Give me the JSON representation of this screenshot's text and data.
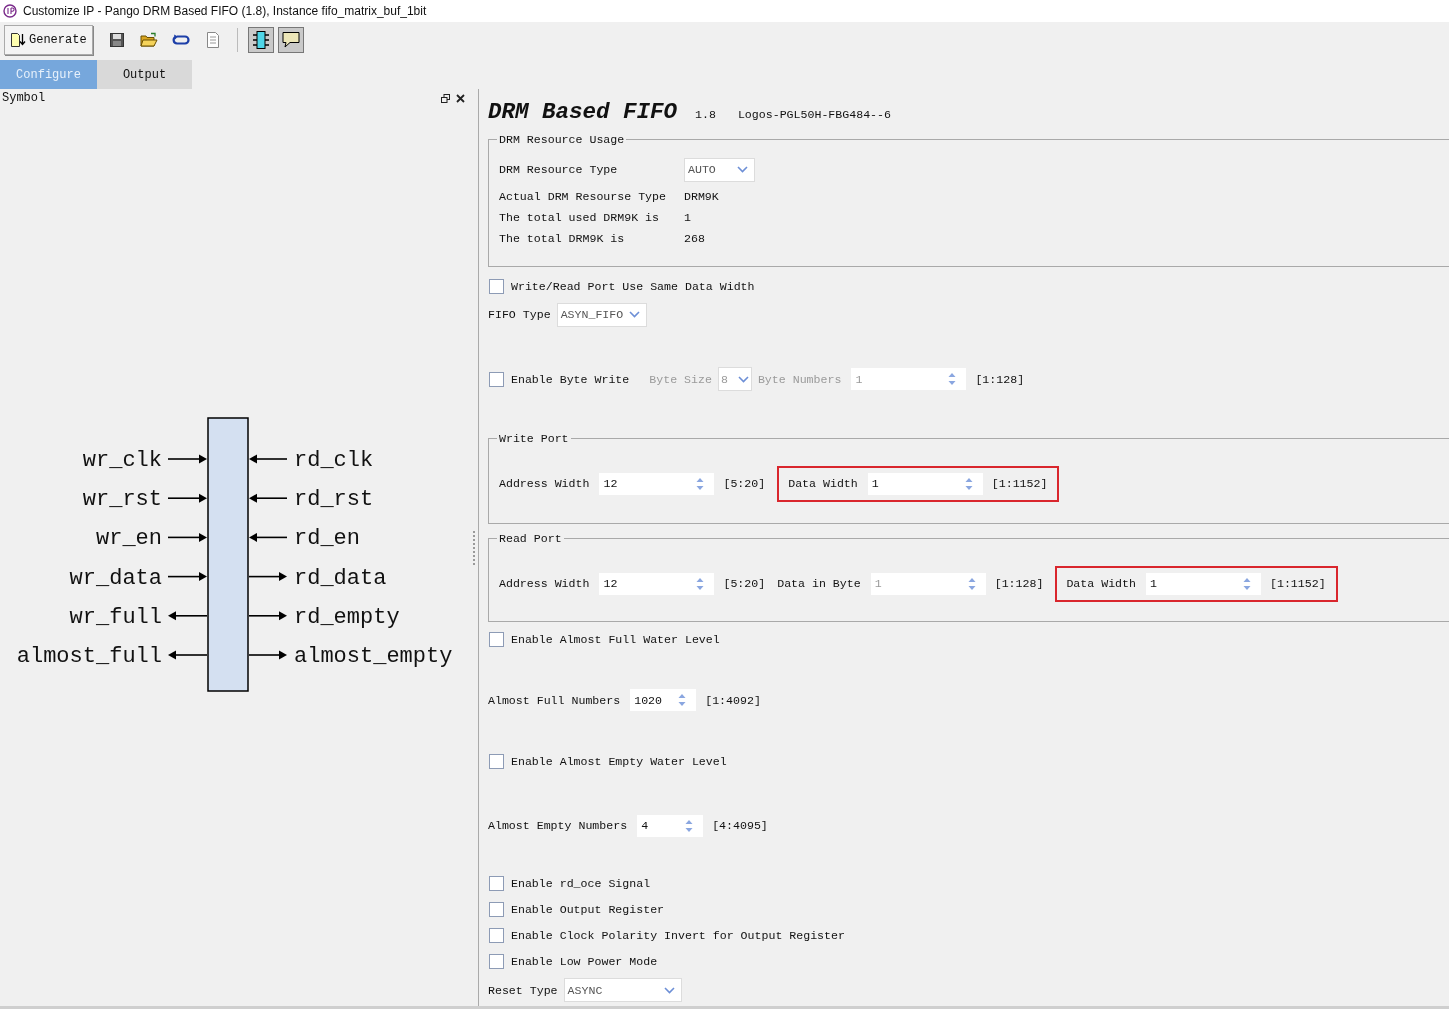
{
  "window": {
    "title": "Customize IP - Pango DRM Based FIFO (1.8), Instance fifo_matrix_buf_1bit"
  },
  "toolbar": [
    {
      "kind": "generate",
      "label": "Generate"
    },
    {
      "kind": "save",
      "pressed": false
    },
    {
      "kind": "open",
      "pressed": false
    },
    {
      "kind": "refresh",
      "pressed": false
    },
    {
      "kind": "document",
      "pressed": false
    },
    {
      "kind": "symbol",
      "pressed": true
    },
    {
      "kind": "comment",
      "pressed": true
    }
  ],
  "tabs": [
    {
      "label": "Configure",
      "selected": true
    },
    {
      "label": "Output",
      "selected": false
    }
  ],
  "symbol_panel": {
    "title": "Symbol",
    "left_pins": [
      {
        "name": "wr_clk",
        "kind": "input"
      },
      {
        "name": "wr_rst",
        "kind": "input"
      },
      {
        "name": "wr_en",
        "kind": "input"
      },
      {
        "name": "wr_data",
        "kind": "input"
      },
      {
        "name": "wr_full",
        "kind": "output"
      },
      {
        "name": "almost_full",
        "kind": "output"
      }
    ],
    "right_pins": [
      {
        "name": "rd_clk",
        "kind": "input"
      },
      {
        "name": "rd_rst",
        "kind": "input"
      },
      {
        "name": "rd_en",
        "kind": "input"
      },
      {
        "name": "rd_data",
        "kind": "output"
      },
      {
        "name": "rd_empty",
        "kind": "output"
      },
      {
        "name": "almost_empty",
        "kind": "output"
      }
    ]
  },
  "config": {
    "title": "DRM Based FIFO",
    "version": "1.8",
    "device": "Logos-PGL50H-FBG484--6",
    "items": [
      {
        "kind": "group",
        "title": "DRM Resource Usage",
        "rows": [
          {
            "label": "DRM Resource Type",
            "field": {
              "kind": "combo",
              "value": "AUTO",
              "disabled": false
            }
          },
          {
            "label": "Actual DRM Resourse Type",
            "field": {
              "kind": "info",
              "value": "DRM9K"
            }
          },
          {
            "label": "The total used DRM9K is",
            "field": {
              "kind": "info",
              "value": "1"
            }
          },
          {
            "label": "The total DRM9K is",
            "field": {
              "kind": "info",
              "value": "268"
            }
          }
        ]
      },
      {
        "kind": "row",
        "fields": [
          {
            "kind": "checkbox",
            "label": "Write/Read Port Use Same Data Width",
            "checked": false
          }
        ]
      },
      {
        "kind": "row",
        "fields": [
          {
            "kind": "label",
            "text": "FIFO Type",
            "disabled": false
          },
          {
            "kind": "combo",
            "value": "ASYN_FIFO",
            "disabled": false
          }
        ]
      },
      {
        "kind": "row",
        "fields": [
          {
            "kind": "checkbox",
            "label": "Enable Byte Write",
            "checked": false
          },
          {
            "kind": "label",
            "text": "Byte Size",
            "disabled": true
          },
          {
            "kind": "combo",
            "value": "8",
            "disabled": true
          },
          {
            "kind": "label",
            "text": "Byte Numbers",
            "disabled": true
          },
          {
            "kind": "spin",
            "value": "1",
            "disabled": true
          },
          {
            "kind": "range",
            "text": "[1:128]"
          }
        ]
      },
      {
        "kind": "portgroup",
        "title": "Write Port",
        "fields": [
          {
            "kind": "label",
            "text": "Address Width",
            "disabled": false
          },
          {
            "kind": "spin",
            "value": "12",
            "disabled": false
          },
          {
            "kind": "range",
            "text": "[5:20]"
          },
          {
            "kind": "highlight",
            "fields": [
              {
                "kind": "label",
                "text": "Data Width",
                "disabled": false
              },
              {
                "kind": "spin",
                "value": "1",
                "disabled": false
              },
              {
                "kind": "range",
                "text": "[1:1152]"
              }
            ]
          }
        ]
      },
      {
        "kind": "portgroup",
        "title": "Read Port",
        "fields": [
          {
            "kind": "label",
            "text": "Address Width",
            "disabled": false
          },
          {
            "kind": "spin",
            "value": "12",
            "disabled": false
          },
          {
            "kind": "range",
            "text": "[5:20]"
          },
          {
            "kind": "label",
            "text": "Data in Byte",
            "disabled": false
          },
          {
            "kind": "spin",
            "value": "1",
            "disabled": true
          },
          {
            "kind": "range",
            "text": "[1:128]"
          },
          {
            "kind": "highlight",
            "fields": [
              {
                "kind": "label",
                "text": "Data Width",
                "disabled": false
              },
              {
                "kind": "spin",
                "value": "1",
                "disabled": false
              },
              {
                "kind": "range",
                "text": "[1:1152]"
              }
            ]
          }
        ]
      },
      {
        "kind": "row",
        "fields": [
          {
            "kind": "checkbox",
            "label": "Enable Almost Full Water Level",
            "checked": false
          }
        ]
      },
      {
        "kind": "row",
        "fields": [
          {
            "kind": "label",
            "text": "Almost Full Numbers",
            "disabled": false
          },
          {
            "kind": "spin",
            "value": "1020",
            "disabled": false
          },
          {
            "kind": "range",
            "text": "[1:4092]"
          }
        ]
      },
      {
        "kind": "row",
        "fields": [
          {
            "kind": "checkbox",
            "label": "Enable Almost Empty Water Level",
            "checked": false
          }
        ]
      },
      {
        "kind": "row",
        "fields": [
          {
            "kind": "label",
            "text": "Almost Empty Numbers",
            "disabled": false
          },
          {
            "kind": "spin",
            "value": "4",
            "disabled": false
          },
          {
            "kind": "range",
            "text": "[4:4095]"
          }
        ]
      },
      {
        "kind": "row",
        "fields": [
          {
            "kind": "checkbox",
            "label": "Enable rd_oce Signal",
            "checked": false
          }
        ]
      },
      {
        "kind": "row",
        "fields": [
          {
            "kind": "checkbox",
            "label": "Enable Output Register",
            "checked": false
          }
        ]
      },
      {
        "kind": "row",
        "fields": [
          {
            "kind": "checkbox",
            "label": "Enable Clock Polarity Invert for Output Register",
            "checked": false
          }
        ]
      },
      {
        "kind": "row",
        "fields": [
          {
            "kind": "checkbox",
            "label": "Enable Low Power Mode",
            "checked": false
          }
        ]
      },
      {
        "kind": "row",
        "fields": [
          {
            "kind": "label",
            "text": "Reset Type",
            "disabled": false
          },
          {
            "kind": "combo",
            "value": "ASYNC",
            "disabled": false
          }
        ]
      }
    ]
  }
}
